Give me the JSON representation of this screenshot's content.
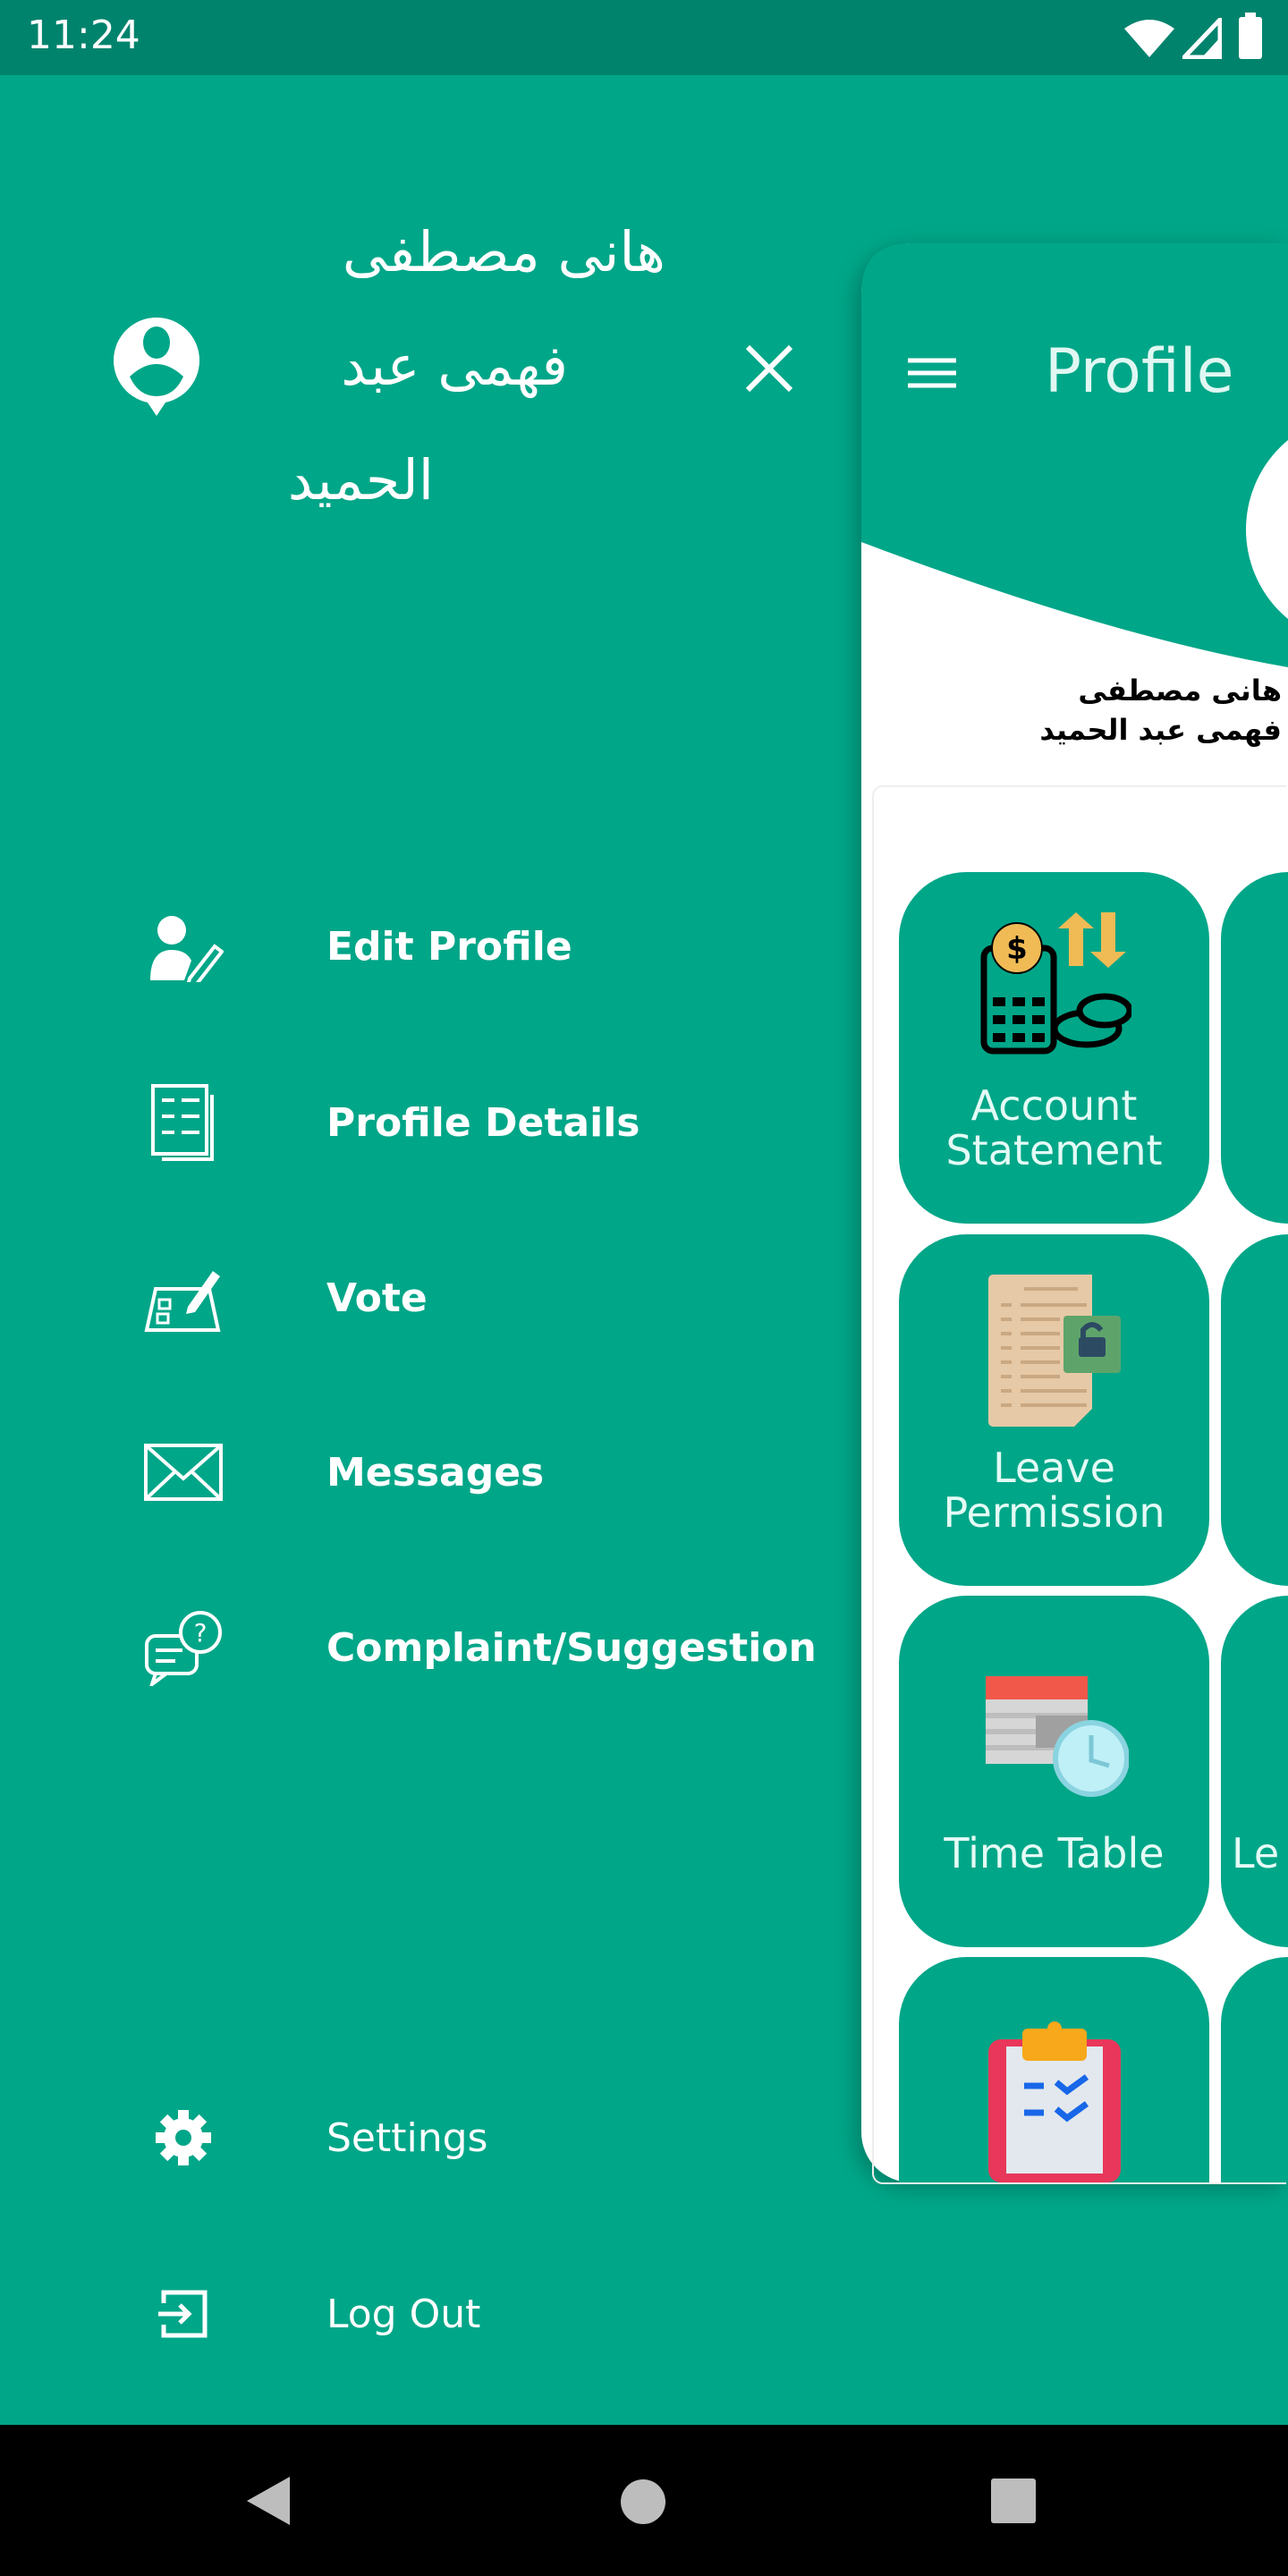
{
  "status_bar": {
    "time": "11:24",
    "icons": [
      "wifi-icon",
      "signal-icon",
      "battery-icon"
    ]
  },
  "drawer": {
    "user_name_lines": [
      "هانى مصطفى",
      "فهمى عبد",
      "الحميد"
    ],
    "avatar_icon": "user-pin-icon",
    "close_icon": "close-icon",
    "menu": [
      {
        "label": "Edit Profile",
        "icon": "edit-profile-icon"
      },
      {
        "label": "Profile Details",
        "icon": "document-list-icon"
      },
      {
        "label": "Vote",
        "icon": "ballot-icon"
      },
      {
        "label": "Messages",
        "icon": "envelope-icon"
      },
      {
        "label": "Complaint/Suggestion",
        "icon": "chat-question-icon"
      }
    ],
    "footer": [
      {
        "label": "Settings",
        "icon": "gear-icon"
      },
      {
        "label": "Log Out",
        "icon": "logout-icon"
      }
    ]
  },
  "main": {
    "title": "Profile",
    "user_name": "هانى مصطفى فهمى عبد الحميد",
    "tiles": [
      {
        "label_lines": [
          "Account",
          "Statement"
        ],
        "icon": "account-statement-icon"
      },
      {
        "label_lines": [
          "Leave",
          "Permission"
        ],
        "icon": "leave-permission-icon"
      },
      {
        "label_lines": [
          "Time Table"
        ],
        "icon": "timetable-icon"
      },
      {
        "label_lines": [
          ""
        ],
        "icon": "checklist-icon"
      }
    ],
    "partial_tile_label": "Le"
  },
  "colors": {
    "primary": "#00a688",
    "status_bar": "#00836d",
    "tile_text": "#e3fbf5"
  }
}
